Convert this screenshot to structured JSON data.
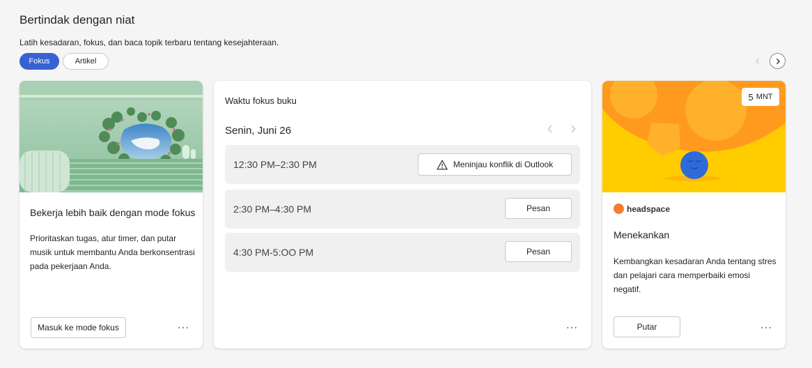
{
  "section": {
    "title": "Bertindak dengan niat",
    "subtitle": "Latih kesadaran, fokus, dan baca topik terbaru tentang kesejahteraan."
  },
  "filters": [
    {
      "label": "Fokus",
      "active": true
    },
    {
      "label": "Artikel",
      "active": false
    }
  ],
  "cards": {
    "focus_mode": {
      "heading": "Bekerja lebih baik dengan mode fokus",
      "description": "Prioritaskan tugas, atur timer, dan putar musik untuk membantu Anda berkonsentrasi pada pekerjaan Anda.",
      "button": "Masuk ke mode fokus",
      "more": "···"
    },
    "book_focus": {
      "title": "Waktu fokus buku",
      "date": "Senin, Juni 26",
      "slots": [
        {
          "time": "12:30 PM–2:30 PM",
          "action": "Meninjau konflik di Outlook",
          "icon": "warning-icon"
        },
        {
          "time": "2:30 PM–4:30 PM",
          "action": "Pesan"
        },
        {
          "time": "4:30 PM-5:OO PM",
          "action": "Pesan"
        }
      ],
      "more": "···"
    },
    "headspace": {
      "badge_number": "5",
      "badge_unit": "MNT",
      "brand": "headspace",
      "heading": "Menekankan",
      "description": "Kembangkan kesadaran Anda tentang stres dan pelajari cara memperbaiki emosi negatif.",
      "button": "Putar",
      "more": "···"
    }
  },
  "colors": {
    "accent": "#3762d3",
    "headspace_orange": "#f47d31",
    "headspace_yellow": "#ffcc00",
    "headspace_blue": "#2f6bd8"
  }
}
